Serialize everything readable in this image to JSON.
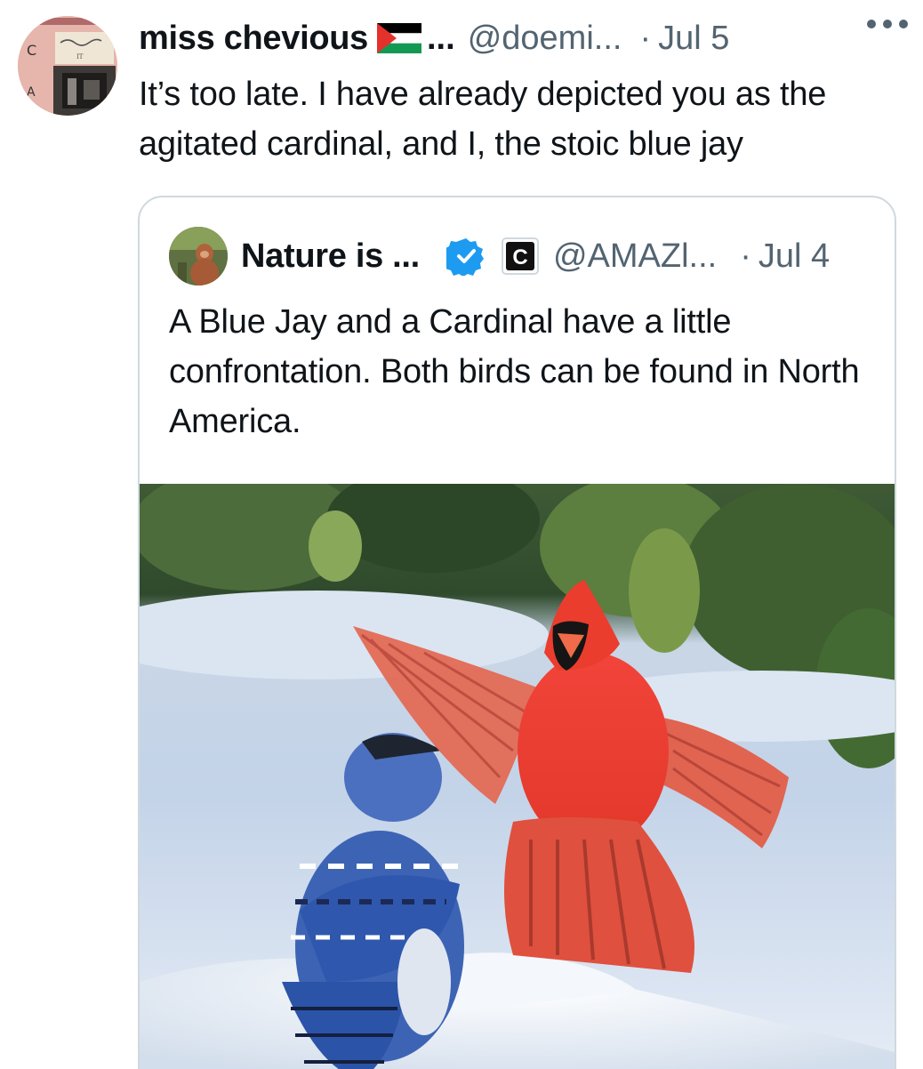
{
  "tweet": {
    "display_name": "miss chevious",
    "name_ellipsis": "...",
    "handle": "@doemi...",
    "separator": "·",
    "date": "Jul 5",
    "text": "It’s too late. I have already depicted you as the agitated cardinal, and I, the stoic blue jay",
    "icons": {
      "flag": "palestine-flag-icon",
      "more": "more-options-icon"
    }
  },
  "quote": {
    "display_name": "Nature is ...",
    "handle": "@AMAZl...",
    "separator": "·",
    "date": "Jul 4",
    "affiliate_letter": "C",
    "text": "A Blue Jay and a Cardinal have a little confrontation. Both birds can be found in North America.",
    "icons": {
      "verified": "verified-badge-icon",
      "affiliate": "affiliate-badge-icon"
    },
    "media": {
      "type": "photo"
    }
  },
  "colors": {
    "text": "#0f1419",
    "secondary": "#536471",
    "border": "#cfd9de",
    "verified_blue": "#1d9bf0"
  }
}
